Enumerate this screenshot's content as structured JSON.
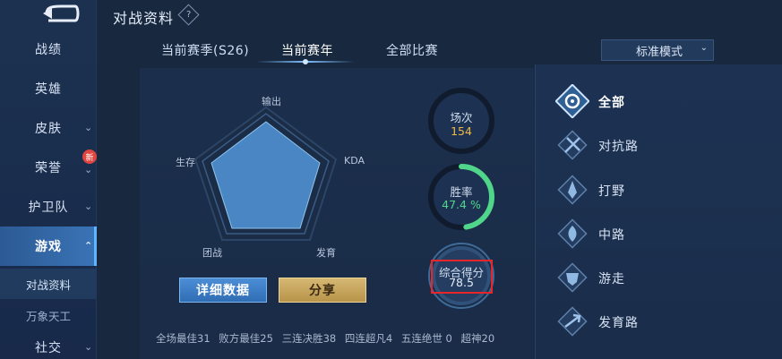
{
  "header": {
    "title": "对战资料",
    "help": "?"
  },
  "sidebar": {
    "items": [
      {
        "label": "战绩",
        "chevron": ""
      },
      {
        "label": "英雄",
        "chevron": ""
      },
      {
        "label": "皮肤",
        "chevron": "⌄"
      },
      {
        "label": "荣誉",
        "chevron": "⌄",
        "badge": "新"
      },
      {
        "label": "护卫队",
        "chevron": "⌄"
      },
      {
        "label": "游戏",
        "chevron": "⌃"
      },
      {
        "label": "社交",
        "chevron": "⌄"
      }
    ],
    "subitems": [
      {
        "label": "对战资料"
      },
      {
        "label": "万象天工"
      }
    ]
  },
  "tabs": [
    {
      "label": "当前赛季(S26)"
    },
    {
      "label": "当前赛年"
    },
    {
      "label": "全部比赛"
    }
  ],
  "mode_select": {
    "value": "标准模式",
    "caret": "⌄"
  },
  "radar": {
    "labels": {
      "top": "输出",
      "right": "KDA",
      "bottom_right": "发育",
      "bottom_left": "团战",
      "left": "生存"
    }
  },
  "buttons": {
    "detail": "详细数据",
    "share": "分享"
  },
  "rings": {
    "matches": {
      "label": "场次",
      "value": "154",
      "color": "#f0b84a"
    },
    "winrate": {
      "label": "胜率",
      "value": "47.4 %",
      "color": "#4fd68a",
      "fraction": 0.474
    },
    "score": {
      "label": "综合得分",
      "value": "78.5",
      "color": "#e3ecf8"
    }
  },
  "stats": [
    "全场最佳31",
    "败方最佳25",
    "三连决胜38",
    "四连超凡4",
    "五连绝世 0",
    "超神20"
  ],
  "roles": [
    {
      "label": "全部",
      "icon": "all-roles-icon"
    },
    {
      "label": "对抗路",
      "icon": "clash-lane-icon"
    },
    {
      "label": "打野",
      "icon": "jungle-icon"
    },
    {
      "label": "中路",
      "icon": "mid-lane-icon"
    },
    {
      "label": "游走",
      "icon": "roam-icon"
    },
    {
      "label": "发育路",
      "icon": "farm-lane-icon"
    }
  ]
}
